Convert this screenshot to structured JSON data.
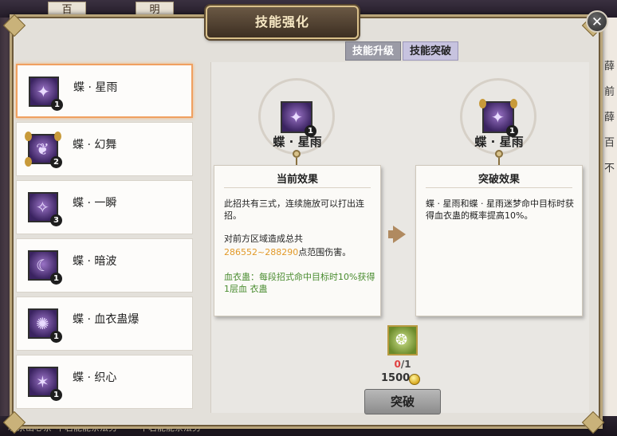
{
  "window": {
    "title": "技能强化",
    "close_label": "✕"
  },
  "tabs": [
    {
      "label": "技能升级",
      "active": false
    },
    {
      "label": "技能突破",
      "active": true
    }
  ],
  "skills": [
    {
      "name": "蝶 · 星雨",
      "level": "1",
      "icon": "butterfly-star-rain-icon",
      "selected": true
    },
    {
      "name": "蝶 · 幻舞",
      "level": "2",
      "icon": "butterfly-phantom-dance-icon",
      "selected": false
    },
    {
      "name": "蝶 · 一瞬",
      "level": "3",
      "icon": "butterfly-instant-icon",
      "selected": false
    },
    {
      "name": "蝶 · 暗波",
      "level": "1",
      "icon": "butterfly-dark-wave-icon",
      "selected": false
    },
    {
      "name": "蝶 · 血衣蛊爆",
      "level": "1",
      "icon": "butterfly-blood-gu-burst-icon",
      "selected": false
    },
    {
      "name": "蝶 · 织心",
      "level": "1",
      "icon": "butterfly-weave-heart-icon",
      "selected": false
    }
  ],
  "current": {
    "skill_name": "蝶 · 星雨",
    "level": "1",
    "card_title": "当前效果",
    "line1": "此招共有三式，连续施放可以打出连招。",
    "line2": "对前方区域造成总共",
    "damage": "286552~288290",
    "line3": "点范围伤害。",
    "extra": "血衣蛊：每段招式命中目标时10%获得1层血 衣蛊"
  },
  "breakthrough": {
    "skill_name": "蝶 · 星雨",
    "level": "1",
    "card_title": "突破效果",
    "text": "蝶 · 星雨和蝶 · 星雨迷梦命中目标时获得血衣蛊的概率提高10%。"
  },
  "material": {
    "icon": "jade-material-icon",
    "have": "0",
    "need": "/1"
  },
  "cost": {
    "amount": "1500",
    "icon": "coin-icon"
  },
  "action": {
    "label": "突破"
  },
  "background": {
    "top_tabs": [
      "百",
      "明"
    ],
    "right_chars": [
      "薛",
      "前",
      "薛",
      "百",
      "不"
    ],
    "bottom_texts": [
      "心茶山心茶",
      "中君能能茶法务",
      "中君能能茶法务"
    ]
  }
}
